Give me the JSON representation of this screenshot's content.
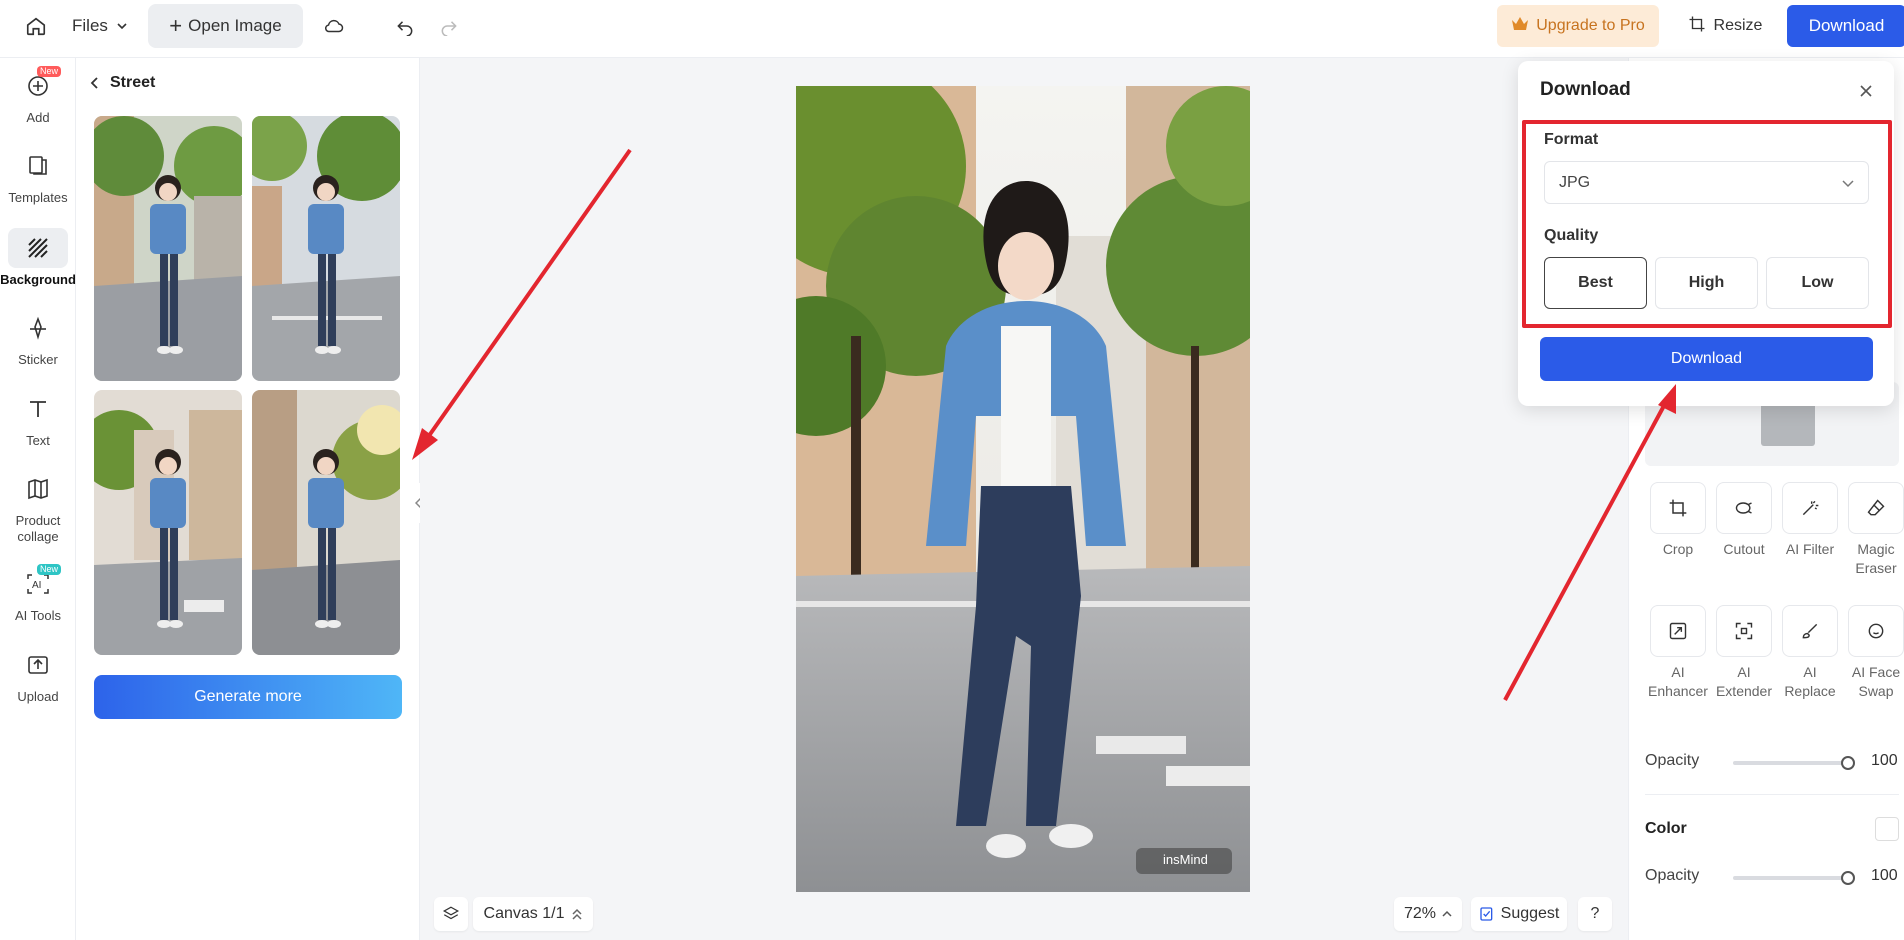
{
  "topbar": {
    "home_icon": "home-icon",
    "files_label": "Files",
    "open_image_label": "Open Image",
    "upgrade_label": "Upgrade to Pro",
    "resize_label": "Resize",
    "download_label": "Download"
  },
  "leftnav": {
    "items": [
      {
        "label": "Add",
        "icon": "add-icon",
        "badge": "New"
      },
      {
        "label": "Templates",
        "icon": "templates-icon"
      },
      {
        "label": "Background",
        "icon": "background-icon"
      },
      {
        "label": "Sticker",
        "icon": "sticker-icon"
      },
      {
        "label": "Text",
        "icon": "text-icon"
      },
      {
        "label": "Product collage",
        "icon": "collage-icon"
      },
      {
        "label": "AI Tools",
        "icon": "ai-tools-icon",
        "badge": "New"
      },
      {
        "label": "Upload",
        "icon": "upload-icon"
      }
    ]
  },
  "panel": {
    "title": "Street",
    "generate_label": "Generate more"
  },
  "canvas": {
    "watermark": "insMind",
    "canvas_label": "Canvas 1/1",
    "zoom": "72%",
    "suggest_label": "Suggest",
    "help_label": "?"
  },
  "rightpanel": {
    "tools_row1": [
      "Crop",
      "Cutout",
      "AI Filter",
      "Magic Eraser"
    ],
    "tools_row2": [
      "AI Enhancer",
      "AI Extender",
      "AI Replace",
      "AI Face Swap"
    ],
    "opacity_label": "Opacity",
    "opacity_value": "100",
    "color_label": "Color",
    "opacity2_label": "Opacity",
    "opacity2_value": "100"
  },
  "dialog": {
    "title": "Download",
    "format_label": "Format",
    "format_value": "JPG",
    "quality_label": "Quality",
    "quality_options": [
      "Best",
      "High",
      "Low"
    ],
    "quality_selected": "Best",
    "download_label": "Download"
  },
  "colors": {
    "accent": "#2b5be8",
    "annotation_red": "#e3262f",
    "upgrade_bg": "#fdebd7",
    "upgrade_text": "#c7731f"
  }
}
